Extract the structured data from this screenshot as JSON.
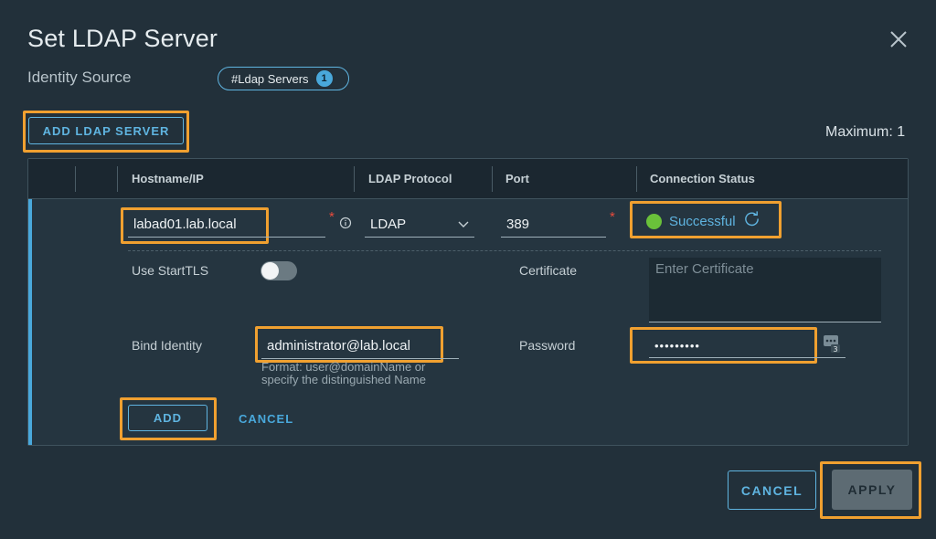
{
  "dialog": {
    "title": "Set LDAP Server"
  },
  "identity_source": {
    "label": "Identity Source",
    "pill_label": "#Ldap Servers",
    "pill_count": "1"
  },
  "toolbar": {
    "add_ldap_server_label": "ADD LDAP SERVER",
    "maximum_text": "Maximum: 1"
  },
  "grid": {
    "columns": [
      "Hostname/IP",
      "LDAP Protocol",
      "Port",
      "Connection Status"
    ]
  },
  "row": {
    "hostname": "labad01.lab.local",
    "required_mark": "*",
    "protocol": "LDAP",
    "port": "389",
    "status_text": "Successful",
    "status_color": "#6ac13a",
    "use_starttls_label": "Use StartTLS",
    "starttls_enabled": false,
    "certificate_label": "Certificate",
    "certificate_placeholder": "Enter Certificate",
    "bind_identity_label": "Bind Identity",
    "bind_identity_value": "administrator@lab.local",
    "bind_identity_hint_line1": "Format: user@domainName or",
    "bind_identity_hint_line2": "specify the distinguished Name",
    "password_label": "Password",
    "password_value": "•••••••••",
    "password_manager_badge": "3",
    "add_label": "ADD",
    "cancel_label": "CANCEL"
  },
  "footer": {
    "cancel_label": "CANCEL",
    "apply_label": "APPLY"
  },
  "colors": {
    "accent": "#49a8db",
    "highlight": "#f0a030",
    "background": "#22303a",
    "required": "#e64b3c"
  },
  "icons": [
    "close-icon",
    "info-icon",
    "chevron-down-icon",
    "refresh-icon",
    "password-manager-icon"
  ]
}
